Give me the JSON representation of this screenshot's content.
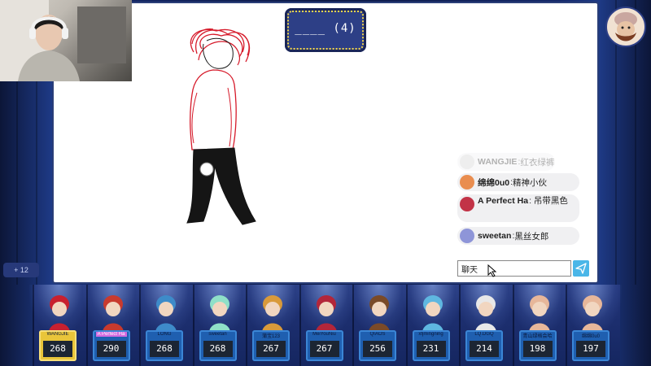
{
  "hint": {
    "word": "____ (4)"
  },
  "score_delta": "+ 12",
  "chat": {
    "messages": [
      {
        "name": "WANGJIE",
        "sep": ": ",
        "text": "红衣绿裤",
        "faded": true
      },
      {
        "name": "绵绵0u0",
        "sep": ": ",
        "text": "精神小伙",
        "faded": false
      },
      {
        "name": "A Perfect Ha",
        "sep": ": ",
        "text": "吊带黑色",
        "faded": false
      },
      {
        "name": "sweetan",
        "sep": ": ",
        "text": "黑丝女郎",
        "faded": false
      }
    ],
    "input_value": "聊天"
  },
  "players": [
    {
      "name": "WANGJIE",
      "score": "268"
    },
    {
      "name": "A Perfect Ha",
      "score": "290"
    },
    {
      "name": "LONG",
      "score": "268"
    },
    {
      "name": "sweetan",
      "score": "268"
    },
    {
      "name": "蒲宝123",
      "score": "267"
    },
    {
      "name": "MeiYouNiu",
      "score": "267"
    },
    {
      "name": "QIAOS",
      "score": "256"
    },
    {
      "name": "xfjmingning",
      "score": "231"
    },
    {
      "name": "LQ.DGQ",
      "score": "214"
    },
    {
      "name": "青山绿格会哈",
      "score": "198"
    },
    {
      "name": "绵绵0u0",
      "score": "197"
    }
  ],
  "colors": {
    "accent": "#4ab6e8",
    "plate": "#1f5fb0",
    "highlight_plate": "#e9c53a",
    "sketch_red": "#d61a2a",
    "sketch_black": "#151515"
  },
  "icons": [
    "send-icon",
    "cursor-icon",
    "avatar-icon"
  ]
}
